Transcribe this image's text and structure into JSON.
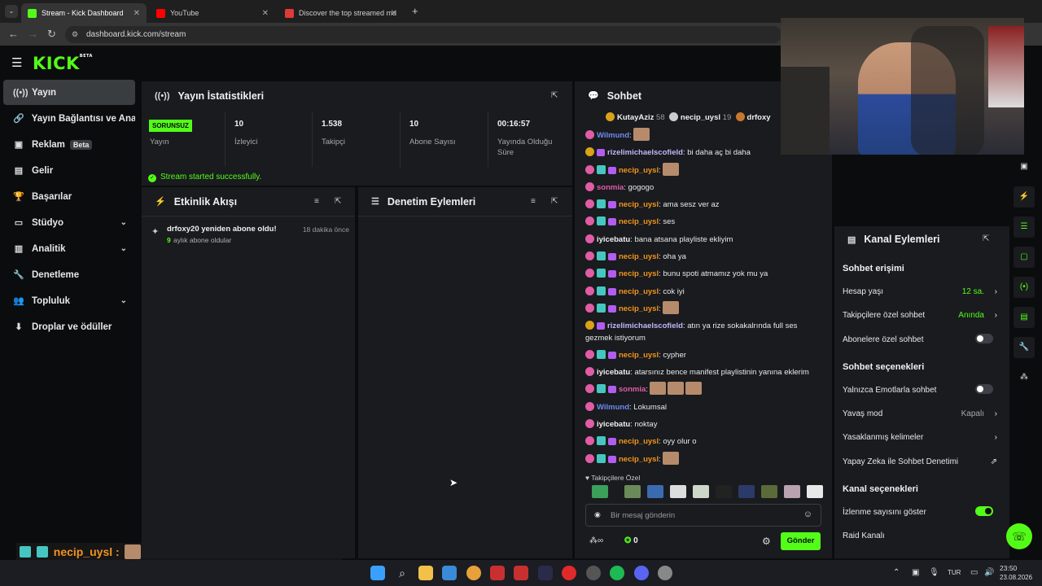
{
  "browser": {
    "tabs": [
      {
        "title": "Stream - Kick Dashboard",
        "color": "#53fc18"
      },
      {
        "title": "YouTube",
        "color": "#ff0000"
      },
      {
        "title": "Discover the top streamed mu",
        "color": "#e03a3a"
      }
    ],
    "url": "dashboard.kick.com/stream"
  },
  "brand": {
    "logo": "KICK",
    "logo_tag": "BETA",
    "accent": "#53fc18"
  },
  "sidebar": {
    "items": [
      {
        "label": "Yayın",
        "icon": "broadcast-icon"
      },
      {
        "label": "Yayın Bağlantısı ve Anahtarı",
        "icon": "link-icon"
      },
      {
        "label": "Reklam",
        "icon": "ad-icon",
        "badge": "Beta"
      },
      {
        "label": "Gelir",
        "icon": "revenue-icon"
      },
      {
        "label": "Başarılar",
        "icon": "trophy-icon"
      },
      {
        "label": "Stüdyo",
        "icon": "studio-icon"
      },
      {
        "label": "Analitik",
        "icon": "analytics-icon"
      },
      {
        "label": "Denetleme",
        "icon": "wrench-icon"
      },
      {
        "label": "Topluluk",
        "icon": "community-icon"
      },
      {
        "label": "Droplar ve ödüller",
        "icon": "drops-icon"
      }
    ]
  },
  "stats": {
    "title": "Yayın İstatistikleri",
    "status_badge": "SORUNSUZ",
    "status_label": "Yayın",
    "cells": [
      {
        "value": "10",
        "label": "İzleyici"
      },
      {
        "value": "1.538",
        "label": "Takipçi"
      },
      {
        "value": "10",
        "label": "Abone Sayısı"
      },
      {
        "value": "00:16:57",
        "label": "Yayında Olduğu Süre"
      }
    ],
    "success_msg": "Stream started successfully."
  },
  "activity": {
    "title": "Etkinlik Akışı",
    "item_title": "drfoxy20 yeniden abone oldu!",
    "item_time": "18 dakika önce",
    "item_months": "9",
    "item_sub": "aylık abone oldular"
  },
  "moderation": {
    "title": "Denetim Eylemleri"
  },
  "chat": {
    "title": "Sohbet",
    "top_gifters": [
      {
        "name": "KutayAziz",
        "count": "58"
      },
      {
        "name": "necip_uysl",
        "count": "19"
      },
      {
        "name": "drfoxy",
        "count": ""
      }
    ],
    "messages": [
      {
        "user": "Wilmund",
        "text": ":",
        "cls": "u-blue"
      },
      {
        "user": "rizelimichaelscofield",
        "text": ": bi daha aç bi daha",
        "cls": "u-lav"
      },
      {
        "user": "necip_uysl",
        "text": ":",
        "cls": "u-orange"
      },
      {
        "user": "sonmia",
        "text": ": gogogo",
        "cls": "u-pink"
      },
      {
        "user": "necip_uysl",
        "text": ": ama sesz ver az",
        "cls": "u-orange"
      },
      {
        "user": "necip_uysl",
        "text": ": ses",
        "cls": "u-orange"
      },
      {
        "user": "iyicebatu",
        "text": ": bana atsana playliste ekliyim",
        "cls": "u-white"
      },
      {
        "user": "necip_uysl",
        "text": ": oha ya",
        "cls": "u-orange"
      },
      {
        "user": "necip_uysl",
        "text": ": bunu spoti atmamız yok mu ya",
        "cls": "u-orange"
      },
      {
        "user": "necip_uysl",
        "text": ": cok iyi",
        "cls": "u-orange"
      },
      {
        "user": "necip_uysl",
        "text": ":",
        "cls": "u-orange"
      },
      {
        "user": "rizelimichaelscofield",
        "text": ": atın ya rize sokakalrında full ses",
        "cls": "u-lav"
      },
      {
        "user": "",
        "text": "gezmek istiyorum",
        "cls": "u-white"
      },
      {
        "user": "necip_uysl",
        "text": ": cypher",
        "cls": "u-orange"
      },
      {
        "user": "iyicebatu",
        "text": ": atarsınız bence manifest playlistinin yanına eklerim",
        "cls": "u-white"
      },
      {
        "user": "sonmia",
        "text": ":",
        "cls": "u-pink"
      },
      {
        "user": "Wilmund",
        "text": ": Lokumsal",
        "cls": "u-blue"
      },
      {
        "user": "iyicebatu",
        "text": ": noktay",
        "cls": "u-white"
      },
      {
        "user": "necip_uysl",
        "text": ": oyy olur o",
        "cls": "u-orange"
      },
      {
        "user": "necip_uysl",
        "text": ":",
        "cls": "u-orange"
      }
    ],
    "followers_only": "Takipçilere Özel",
    "input_placeholder": "Bir mesaj gönderin",
    "send_label": "Gönder",
    "points": "0",
    "overlay_user": "necip_uysl :"
  },
  "channel_actions": {
    "title": "Kanal Eylemleri",
    "chat_access": "Sohbet erişimi",
    "account_age": "Hesap yaşı",
    "account_age_val": "12 sa.",
    "followers_chat": "Takipçilere özel sohbet",
    "followers_chat_val": "Anında",
    "subs_chat": "Abonelere özel sohbet",
    "chat_options": "Sohbet seçenekleri",
    "emote_only": "Yalnızca Emotlarla sohbet",
    "slow_mode": "Yavaş mod",
    "slow_mode_val": "Kapalı",
    "banned_words": "Yasaklanmış kelimeler",
    "ai_mod": "Yapay Zeka ile Sohbet Denetimi",
    "channel_options": "Kanal seçenekleri",
    "show_viewers": "İzlenme sayısını göster",
    "raid": "Raid Kanalı"
  },
  "taskbar": {
    "lang": "TUR",
    "time": "23:50",
    "date": "23.08.2026"
  }
}
